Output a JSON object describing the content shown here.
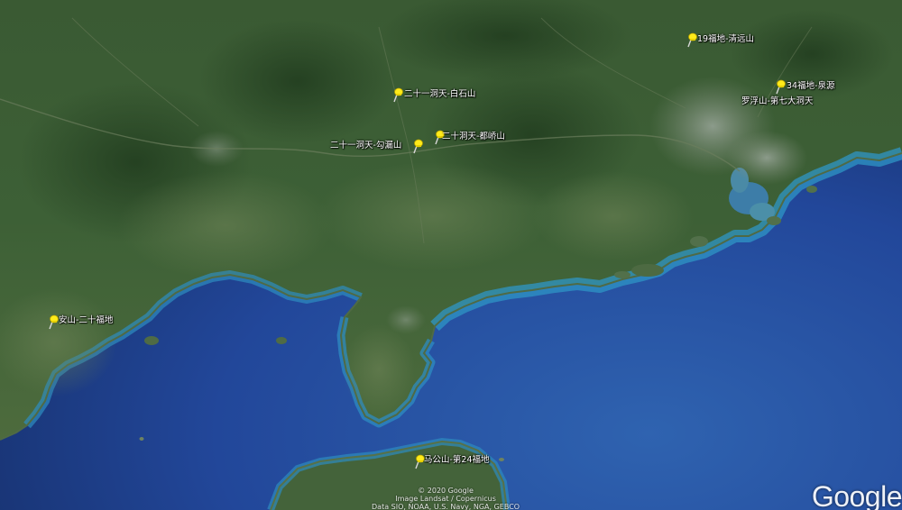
{
  "map": {
    "colors": {
      "ocean_deep": "#1e3f86",
      "ocean_mid": "#2a5aa4",
      "shallow": "#2f8fc0",
      "land_dark": "#2c4a28",
      "land_mid": "#3f5f36",
      "urban": "#8d9a8a"
    },
    "placemarks": [
      {
        "id": "p1",
        "label": "19福地-清远山",
        "icon": "yellow-pushpin-icon"
      },
      {
        "id": "p2",
        "label": "二十一洞天-白石山",
        "icon": "yellow-pushpin-icon"
      },
      {
        "id": "p3",
        "label": "34福地-泉源",
        "icon": "yellow-pushpin-icon"
      },
      {
        "id": "p3b",
        "label": "罗浮山-第七大洞天",
        "icon": "none"
      },
      {
        "id": "p4",
        "label": "二十洞天-都峤山",
        "icon": "yellow-pushpin-icon"
      },
      {
        "id": "p5",
        "label": "二十一洞天-勾漏山",
        "icon": "yellow-pushpin-icon"
      },
      {
        "id": "p6",
        "label": "安山-二十福地",
        "icon": "yellow-pushpin-icon"
      },
      {
        "id": "p7",
        "label": "马公山-第24福地",
        "icon": "yellow-pushpin-icon"
      }
    ],
    "attribution": [
      "© 2020 Google",
      "Image Landsat / Copernicus",
      "Data SIO, NOAA, U.S. Navy, NGA, GEBCO"
    ],
    "logo": "Google"
  }
}
